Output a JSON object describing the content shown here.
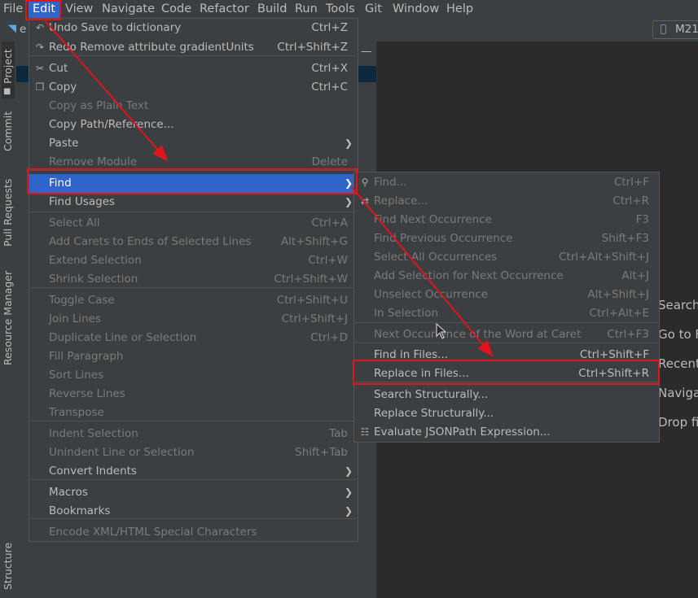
{
  "menubar": {
    "items": [
      "File",
      "Edit",
      "View",
      "Navigate",
      "Code",
      "Refactor",
      "Build",
      "Run",
      "Tools",
      "Git",
      "Window",
      "Help"
    ]
  },
  "toolbar": {
    "device_label": "M21"
  },
  "left_tabs": [
    "Project",
    "Commit",
    "Pull Requests",
    "Resource Manager",
    "Structure"
  ],
  "editor_hints": [
    "Search",
    "Go to F",
    "Recent",
    "Navigat",
    "Drop fil"
  ],
  "edit_menu": {
    "items": [
      {
        "label": "Undo Save  to dictionary",
        "shortcut": "Ctrl+Z",
        "icon": "undo-icon",
        "enabled": true
      },
      {
        "label": "Redo Remove attribute gradientUnits",
        "shortcut": "Ctrl+Shift+Z",
        "icon": "redo-icon",
        "enabled": true
      },
      {
        "label": "Cut",
        "shortcut": "Ctrl+X",
        "icon": "scissors-icon",
        "enabled": true
      },
      {
        "label": "Copy",
        "shortcut": "Ctrl+C",
        "icon": "copy-icon",
        "enabled": true
      },
      {
        "label": "Copy as Plain Text",
        "shortcut": "",
        "enabled": false
      },
      {
        "label": "Copy Path/Reference...",
        "shortcut": "",
        "enabled": true
      },
      {
        "label": "Paste",
        "shortcut": "",
        "submenu": true,
        "enabled": true
      },
      {
        "label": "Remove Module",
        "shortcut": "Delete",
        "enabled": false
      },
      {
        "label": "Find",
        "shortcut": "",
        "submenu": true,
        "enabled": true,
        "highlighted": true
      },
      {
        "label": "Find Usages",
        "shortcut": "",
        "submenu": true,
        "enabled": true
      },
      {
        "label": "Select All",
        "shortcut": "Ctrl+A",
        "enabled": false
      },
      {
        "label": "Add Carets to Ends of Selected Lines",
        "shortcut": "Alt+Shift+G",
        "enabled": false
      },
      {
        "label": "Extend Selection",
        "shortcut": "Ctrl+W",
        "enabled": false
      },
      {
        "label": "Shrink Selection",
        "shortcut": "Ctrl+Shift+W",
        "enabled": false
      },
      {
        "label": "Toggle Case",
        "shortcut": "Ctrl+Shift+U",
        "enabled": false
      },
      {
        "label": "Join Lines",
        "shortcut": "Ctrl+Shift+J",
        "enabled": false
      },
      {
        "label": "Duplicate Line or Selection",
        "shortcut": "Ctrl+D",
        "enabled": false
      },
      {
        "label": "Fill Paragraph",
        "shortcut": "",
        "enabled": false
      },
      {
        "label": "Sort Lines",
        "shortcut": "",
        "enabled": false
      },
      {
        "label": "Reverse Lines",
        "shortcut": "",
        "enabled": false
      },
      {
        "label": "Transpose",
        "shortcut": "",
        "enabled": false
      },
      {
        "label": "Indent Selection",
        "shortcut": "Tab",
        "enabled": false
      },
      {
        "label": "Unindent Line or Selection",
        "shortcut": "Shift+Tab",
        "enabled": false
      },
      {
        "label": "Convert Indents",
        "shortcut": "",
        "submenu": true,
        "enabled": true
      },
      {
        "label": "Macros",
        "shortcut": "",
        "submenu": true,
        "enabled": true
      },
      {
        "label": "Bookmarks",
        "shortcut": "",
        "submenu": true,
        "enabled": true
      },
      {
        "label": "Encode XML/HTML Special Characters",
        "shortcut": "",
        "enabled": false
      }
    ]
  },
  "find_menu": {
    "items": [
      {
        "label": "Find...",
        "shortcut": "Ctrl+F",
        "icon": "search-icon",
        "enabled": false
      },
      {
        "label": "Replace...",
        "shortcut": "Ctrl+R",
        "icon": "replace-icon",
        "enabled": false
      },
      {
        "label": "Find Next Occurrence",
        "shortcut": "F3",
        "enabled": false
      },
      {
        "label": "Find Previous Occurrence",
        "shortcut": "Shift+F3",
        "enabled": false
      },
      {
        "label": "Select All Occurrences",
        "shortcut": "Ctrl+Alt+Shift+J",
        "enabled": false
      },
      {
        "label": "Add Selection for Next Occurrence",
        "shortcut": "Alt+J",
        "enabled": false
      },
      {
        "label": "Unselect Occurrence",
        "shortcut": "Alt+Shift+J",
        "enabled": false
      },
      {
        "label": "In Selection",
        "shortcut": "Ctrl+Alt+E",
        "enabled": false
      },
      {
        "label": "Next Occurrence of the Word at Caret",
        "shortcut": "Ctrl+F3",
        "enabled": false
      },
      {
        "label": "Find in Files...",
        "shortcut": "Ctrl+Shift+F",
        "enabled": true
      },
      {
        "label": "Replace in Files...",
        "shortcut": "Ctrl+Shift+R",
        "enabled": true,
        "boxed": true
      },
      {
        "label": "Search Structurally...",
        "shortcut": "",
        "enabled": true
      },
      {
        "label": "Replace Structurally...",
        "shortcut": "",
        "enabled": true
      },
      {
        "label": "Evaluate JSONPath Expression...",
        "shortcut": "",
        "icon": "jsonpath-icon",
        "enabled": true
      }
    ]
  },
  "colors": {
    "highlight": "#2f65ca",
    "annotation": "#e0141c",
    "menu_bg": "#3c3f41",
    "disabled_text": "#7a7a7a"
  }
}
